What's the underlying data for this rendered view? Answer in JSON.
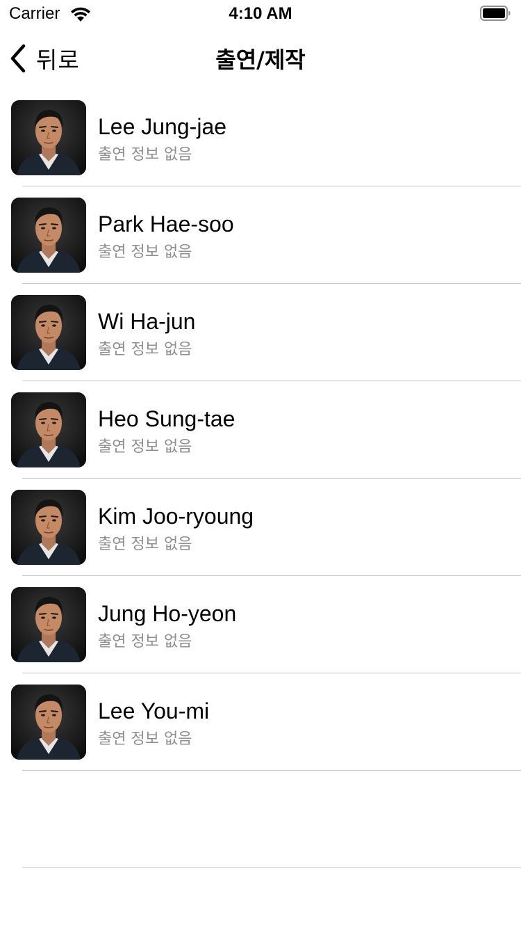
{
  "status_bar": {
    "carrier": "Carrier",
    "time": "4:10 AM"
  },
  "nav": {
    "back_label": "뒤로",
    "title": "출연/제작"
  },
  "people": [
    {
      "name": "Lee Jung-jae",
      "subtitle": "출연 정보 없음"
    },
    {
      "name": "Park Hae-soo",
      "subtitle": "출연 정보 없음"
    },
    {
      "name": "Wi Ha-jun",
      "subtitle": "출연 정보 없음"
    },
    {
      "name": "Heo Sung-tae",
      "subtitle": "출연 정보 없음"
    },
    {
      "name": "Kim Joo-ryoung",
      "subtitle": "출연 정보 없음"
    },
    {
      "name": "Jung Ho-yeon",
      "subtitle": "출연 정보 없음"
    },
    {
      "name": "Lee You-mi",
      "subtitle": "출연 정보 없음"
    }
  ],
  "colors": {
    "subtitle": "#8e8e93",
    "separator": "#c8c7cc"
  }
}
